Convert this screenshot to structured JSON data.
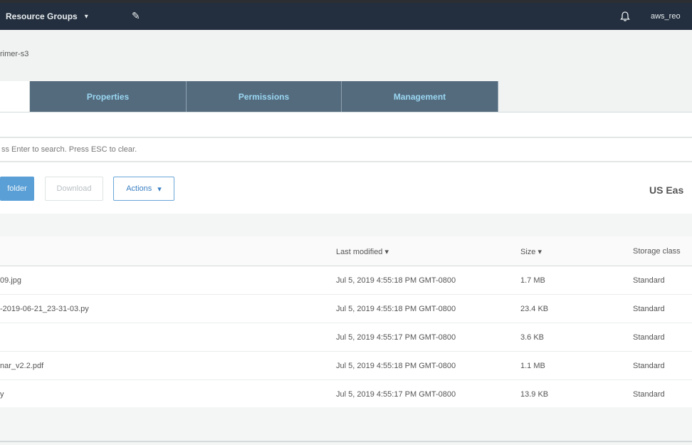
{
  "nav": {
    "resource_groups": "Resource Groups",
    "pin_glyph": "✎",
    "bell_icon": "bell-icon",
    "account": "aws_reo"
  },
  "breadcrumb": "rimer-s3",
  "tabs": [
    {
      "label": ""
    },
    {
      "label": "Properties"
    },
    {
      "label": "Permissions"
    },
    {
      "label": "Management"
    }
  ],
  "search": {
    "placeholder": "ss Enter to search. Press ESC to clear."
  },
  "toolbar": {
    "create_label": "folder",
    "download_label": "Download",
    "actions_label": "Actions"
  },
  "region": "US Eas",
  "table": {
    "headers": {
      "name": "",
      "last_modified": "Last modified ▾",
      "size": "Size ▾",
      "storage_class": "Storage class"
    },
    "rows": [
      {
        "name": "09.jpg",
        "last_modified": "Jul 5, 2019 4:55:18 PM GMT-0800",
        "size": "1.7 MB",
        "storage_class": "Standard"
      },
      {
        "name": "-2019-06-21_23-31-03.py",
        "last_modified": "Jul 5, 2019 4:55:18 PM GMT-0800",
        "size": "23.4 KB",
        "storage_class": "Standard"
      },
      {
        "name": "",
        "last_modified": "Jul 5, 2019 4:55:17 PM GMT-0800",
        "size": "3.6 KB",
        "storage_class": "Standard"
      },
      {
        "name": "nar_v2.2.pdf",
        "last_modified": "Jul 5, 2019 4:55:18 PM GMT-0800",
        "size": "1.1 MB",
        "storage_class": "Standard"
      },
      {
        "name": "y",
        "last_modified": "Jul 5, 2019 4:55:17 PM GMT-0800",
        "size": "13.9 KB",
        "storage_class": "Standard"
      }
    ]
  },
  "colors": {
    "navbar": "#232f3e",
    "tab_dark": "#546b7e",
    "tab_text": "#9ad7f2",
    "primary_button": "#5a9fd6"
  }
}
